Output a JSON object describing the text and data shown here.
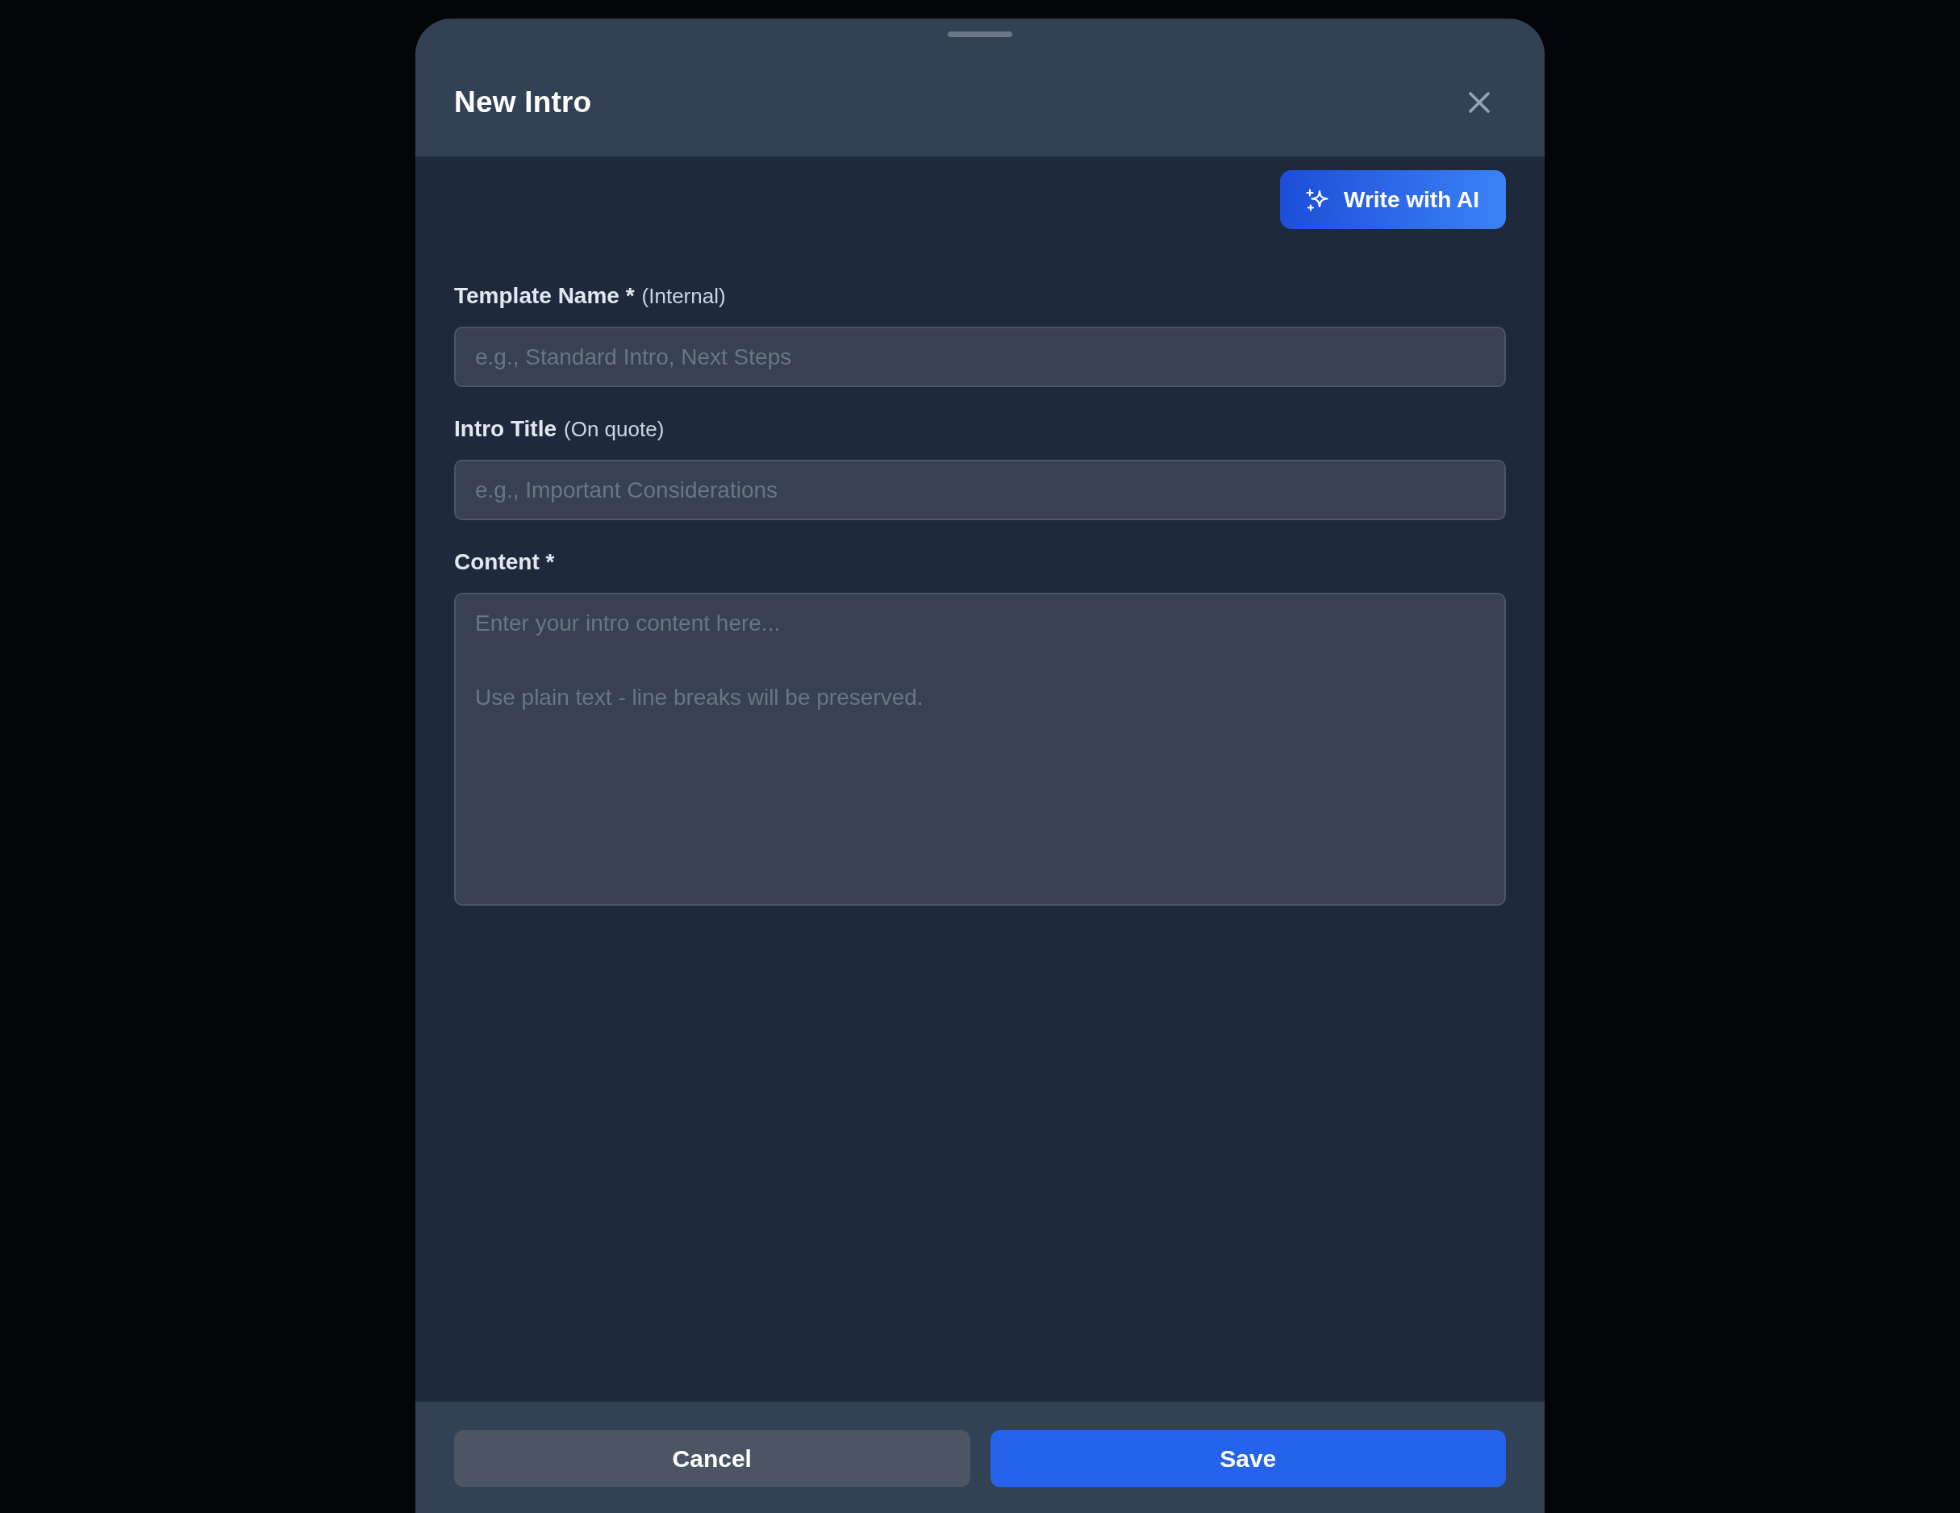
{
  "dialog": {
    "title": "New Intro"
  },
  "ai_button": {
    "label": "Write with AI"
  },
  "fields": [
    {
      "kind": "input",
      "label": "Template Name *",
      "note": "(Internal)",
      "placeholder": "e.g., Standard Intro, Next Steps"
    },
    {
      "kind": "input",
      "label": "Intro Title",
      "note": "(On quote)",
      "placeholder": "e.g., Important Considerations"
    },
    {
      "kind": "textarea",
      "label": "Content *",
      "placeholder": "Enter your intro content here...\n\nUse plain text - line breaks will be preserved."
    }
  ],
  "buttons": [
    {
      "kind": "secondary",
      "label": "Cancel"
    },
    {
      "kind": "primary",
      "label": "Save"
    }
  ]
}
